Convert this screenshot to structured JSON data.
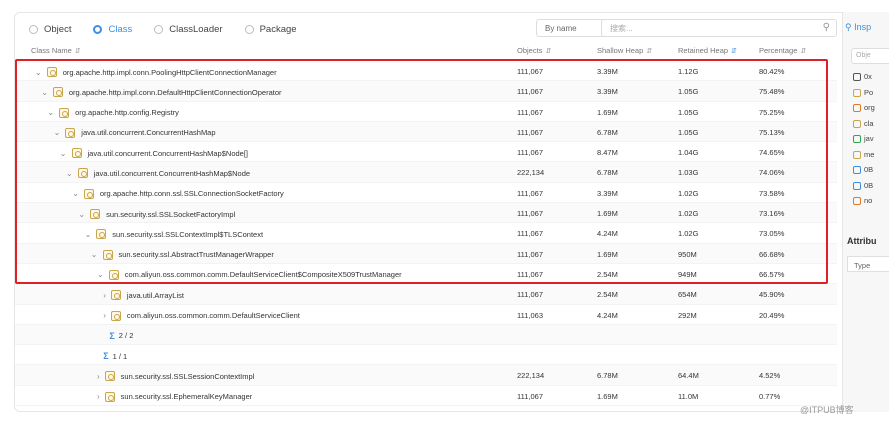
{
  "radios": [
    {
      "label": "Object",
      "active": false
    },
    {
      "label": "Class",
      "active": true
    },
    {
      "label": "ClassLoader",
      "active": false
    },
    {
      "label": "Package",
      "active": false
    }
  ],
  "sort_select": {
    "value": "By name"
  },
  "search": {
    "placeholder": "搜索..."
  },
  "columns": [
    "Class Name",
    "Objects",
    "Shallow Heap",
    "Retained Heap",
    "Percentage"
  ],
  "rows": [
    {
      "name": "org.apache.http.impl.conn.PoolingHttpClientConnectionManager",
      "objects": "111,067",
      "shallow": "3.39M",
      "retained": "1.12G",
      "pct": "80.42%",
      "indent": 0,
      "kind": "class"
    },
    {
      "name": "org.apache.http.impl.conn.DefaultHttpClientConnectionOperator",
      "objects": "111,067",
      "shallow": "3.39M",
      "retained": "1.05G",
      "pct": "75.48%",
      "indent": 1,
      "kind": "class"
    },
    {
      "name": "org.apache.http.config.Registry",
      "objects": "111,067",
      "shallow": "1.69M",
      "retained": "1.05G",
      "pct": "75.25%",
      "indent": 2,
      "kind": "class"
    },
    {
      "name": "java.util.concurrent.ConcurrentHashMap",
      "objects": "111,067",
      "shallow": "6.78M",
      "retained": "1.05G",
      "pct": "75.13%",
      "indent": 3,
      "kind": "class"
    },
    {
      "name": "java.util.concurrent.ConcurrentHashMap$Node[]",
      "objects": "111,067",
      "shallow": "8.47M",
      "retained": "1.04G",
      "pct": "74.65%",
      "indent": 4,
      "kind": "class"
    },
    {
      "name": "java.util.concurrent.ConcurrentHashMap$Node",
      "objects": "222,134",
      "shallow": "6.78M",
      "retained": "1.03G",
      "pct": "74.06%",
      "indent": 5,
      "kind": "class"
    },
    {
      "name": "org.apache.http.conn.ssl.SSLConnectionSocketFactory",
      "objects": "111,067",
      "shallow": "3.39M",
      "retained": "1.02G",
      "pct": "73.58%",
      "indent": 6,
      "kind": "class"
    },
    {
      "name": "sun.security.ssl.SSLSocketFactoryImpl",
      "objects": "111,067",
      "shallow": "1.69M",
      "retained": "1.02G",
      "pct": "73.16%",
      "indent": 7,
      "kind": "class"
    },
    {
      "name": "sun.security.ssl.SSLContextImpl$TLSContext",
      "objects": "111,067",
      "shallow": "4.24M",
      "retained": "1.02G",
      "pct": "73.05%",
      "indent": 8,
      "kind": "class"
    },
    {
      "name": "sun.security.ssl.AbstractTrustManagerWrapper",
      "objects": "111,067",
      "shallow": "1.69M",
      "retained": "950M",
      "pct": "66.68%",
      "indent": 9,
      "kind": "class"
    },
    {
      "name": "com.aliyun.oss.common.comm.DefaultServiceClient$CompositeX509TrustManager",
      "objects": "111,067",
      "shallow": "2.54M",
      "retained": "949M",
      "pct": "66.57%",
      "indent": 10,
      "kind": "class"
    },
    {
      "name": "java.util.ArrayList",
      "objects": "111,067",
      "shallow": "2.54M",
      "retained": "654M",
      "pct": "45.90%",
      "indent": 11,
      "kind": "class"
    },
    {
      "name": "com.aliyun.oss.common.comm.DefaultServiceClient",
      "objects": "111,063",
      "shallow": "4.24M",
      "retained": "292M",
      "pct": "20.49%",
      "indent": 11,
      "kind": "class"
    },
    {
      "name": "2 / 2",
      "objects": "",
      "shallow": "",
      "retained": "",
      "pct": "",
      "indent": 12,
      "kind": "sum"
    },
    {
      "name": "1 / 1",
      "objects": "",
      "shallow": "",
      "retained": "",
      "pct": "",
      "indent": 11,
      "kind": "sum"
    },
    {
      "name": "sun.security.ssl.SSLSessionContextImpl",
      "objects": "222,134",
      "shallow": "6.78M",
      "retained": "64.4M",
      "pct": "4.52%",
      "indent": 10,
      "kind": "class"
    },
    {
      "name": "sun.security.ssl.EphemeralKeyManager",
      "objects": "111,067",
      "shallow": "1.69M",
      "retained": "11.0M",
      "pct": "0.77%",
      "indent": 10,
      "kind": "class"
    }
  ],
  "right_pane": {
    "tab": "Insp",
    "filter": "Obje",
    "items": [
      "0x",
      "Po",
      "org",
      "cla",
      "jav",
      "me",
      "0B",
      "0B",
      "no"
    ],
    "attributes_title": "Attribu",
    "type_label": "Type"
  },
  "watermark": "@ITPUB博客",
  "colors": {
    "accent": "#3d8fe0",
    "highlight": "#e01f26"
  }
}
